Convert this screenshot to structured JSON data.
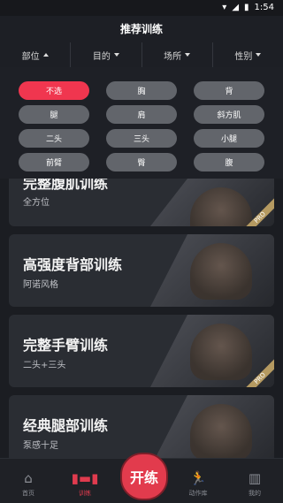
{
  "status": {
    "time": "1:54"
  },
  "header": {
    "title": "推荐训练"
  },
  "filters": [
    {
      "label": "部位",
      "arrow": "up"
    },
    {
      "label": "目的",
      "arrow": "down"
    },
    {
      "label": "场所",
      "arrow": "down"
    },
    {
      "label": "性别",
      "arrow": "down"
    }
  ],
  "chips": [
    "不选",
    "胸",
    "背",
    "腿",
    "肩",
    "斜方肌",
    "二头",
    "三头",
    "小腿",
    "前臂",
    "臀",
    "腹"
  ],
  "active_chip": "不选",
  "cards": [
    {
      "title": "完整腹肌训练",
      "subtitle": "全方位",
      "pro": "PRO"
    },
    {
      "title": "高强度背部训练",
      "subtitle": "阿诺风格",
      "pro": ""
    },
    {
      "title": "完整手臂训练",
      "subtitle": "二头+三头",
      "pro": "PRO"
    },
    {
      "title": "经典腿部训练",
      "subtitle": "泵感十足",
      "pro": ""
    }
  ],
  "tabs": [
    {
      "label": "首页",
      "icon": "home-icon"
    },
    {
      "label": "训练",
      "icon": "dumbbell-icon"
    },
    {
      "label": "动作库",
      "icon": "running-icon"
    },
    {
      "label": "我的",
      "icon": "profile-icon"
    }
  ],
  "start_button": "开练",
  "colors": {
    "accent": "#e23b4e",
    "background": "#1b1d22",
    "chip": "#62656b",
    "pro_badge": "#b59a61"
  }
}
